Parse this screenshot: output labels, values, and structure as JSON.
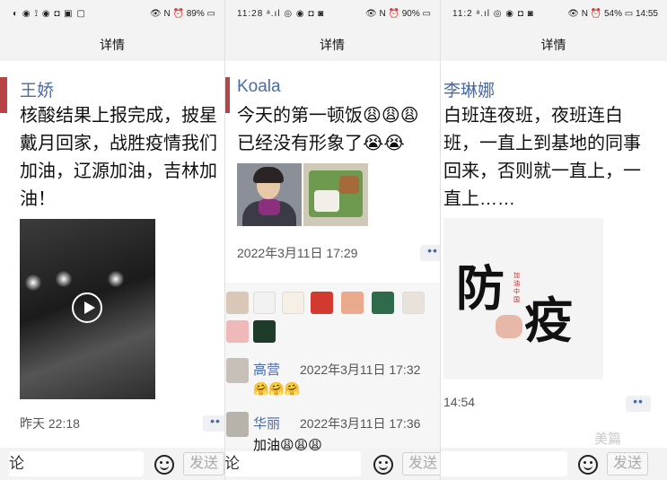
{
  "panels": [
    {
      "status_left": "◐ ◉ ⟟ ◉ ◘ ▣ ▢",
      "status_right": "👁 N ⏰ 89% ▭",
      "title": "详情",
      "nickname": "王娇",
      "text": "核酸结果上报完成，披星\n戴月回家，战胜疫情我们\n加油，辽源加油，吉林加\n油！",
      "timestamp": "昨天 22:18",
      "more": "••",
      "input_text": "论",
      "send_label": "发送"
    },
    {
      "status_left": "11:28 ᵃ.ıl ◎ ◉ ◘ ◙",
      "status_right": "👁 N ⏰ 90% ▭",
      "title": "详情",
      "nickname": "Koala",
      "text": "今天的第一顿饭😩😩😩\n已经没有形象了😭😭",
      "timestamp": "2022年3月11日 17:29",
      "more": "••",
      "comments": [
        {
          "name": "高营",
          "time": "2022年3月11日 17:32",
          "text": "🤗🤗🤗"
        },
        {
          "name": "华丽",
          "time": "2022年3月11日 17:36",
          "text": "加油😩😩😩"
        }
      ],
      "input_text": "论",
      "send_label": "发送"
    },
    {
      "status_left": "11:2 ᵃ.ıl ◎ ◉ ◘ ◙",
      "status_right": "👁 N ⏰ 54% ▭ 14:55",
      "title": "详情",
      "nickname": "李琳娜",
      "text": "白班连夜班，夜班连白\n班，一直上到基地的同事\n回来，否则就一直上，一\n直上……",
      "image_char_1": "防",
      "image_char_2": "疫",
      "image_small": "加油中国",
      "timestamp": "14:54",
      "more": "••",
      "send_label": "发送"
    }
  ],
  "watermark": "美篇"
}
